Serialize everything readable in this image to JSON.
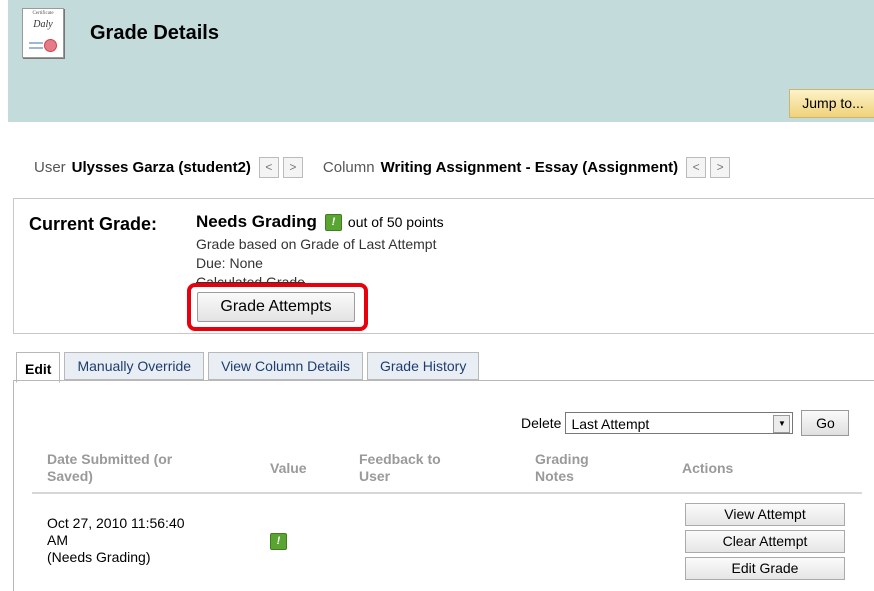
{
  "header": {
    "title": "Grade Details",
    "icon": "certificate-icon",
    "icon_text_top": "Certificate",
    "icon_text_script": "Daly",
    "jump_label": "Jump to..."
  },
  "nav": {
    "user_label": "User",
    "user_value": "Ulysses Garza (student2)",
    "column_label": "Column",
    "column_value": "Writing Assignment - Essay (Assignment)",
    "prev_glyph": "<",
    "next_glyph": ">"
  },
  "current_grade": {
    "label": "Current Grade:",
    "value": "Needs Grading",
    "flag_glyph": "!",
    "out_of": "out of 50 points",
    "based_on": "Grade based on Grade of Last Attempt",
    "due": "Due: None",
    "calculated": "Calculated Grade",
    "grade_attempts_label": "Grade Attempts",
    "highlight_color": "#e8000d"
  },
  "tabs": [
    {
      "label": "Edit",
      "active": true
    },
    {
      "label": "Manually Override",
      "active": false
    },
    {
      "label": "View Column Details",
      "active": false
    },
    {
      "label": "Grade History",
      "active": false
    }
  ],
  "delete": {
    "label": "Delete",
    "selected": "Last Attempt",
    "go_label": "Go"
  },
  "table": {
    "headers": {
      "date_line1": "Date Submitted (or",
      "date_line2": "Saved)",
      "value": "Value",
      "feedback_line1": "Feedback to",
      "feedback_line2": "User",
      "notes_line1": "Grading",
      "notes_line2": "Notes",
      "actions": "Actions"
    },
    "rows": [
      {
        "date_line1": "Oct 27, 2010 11:56:40",
        "date_line2": "AM",
        "status": "(Needs Grading)",
        "value_flag": "!",
        "actions": [
          "View Attempt",
          "Clear Attempt",
          "Edit Grade"
        ]
      }
    ]
  },
  "colors": {
    "header_bg": "#c3dbdb",
    "jump_bg": "#efd27a",
    "flag_green": "#5aa531"
  }
}
